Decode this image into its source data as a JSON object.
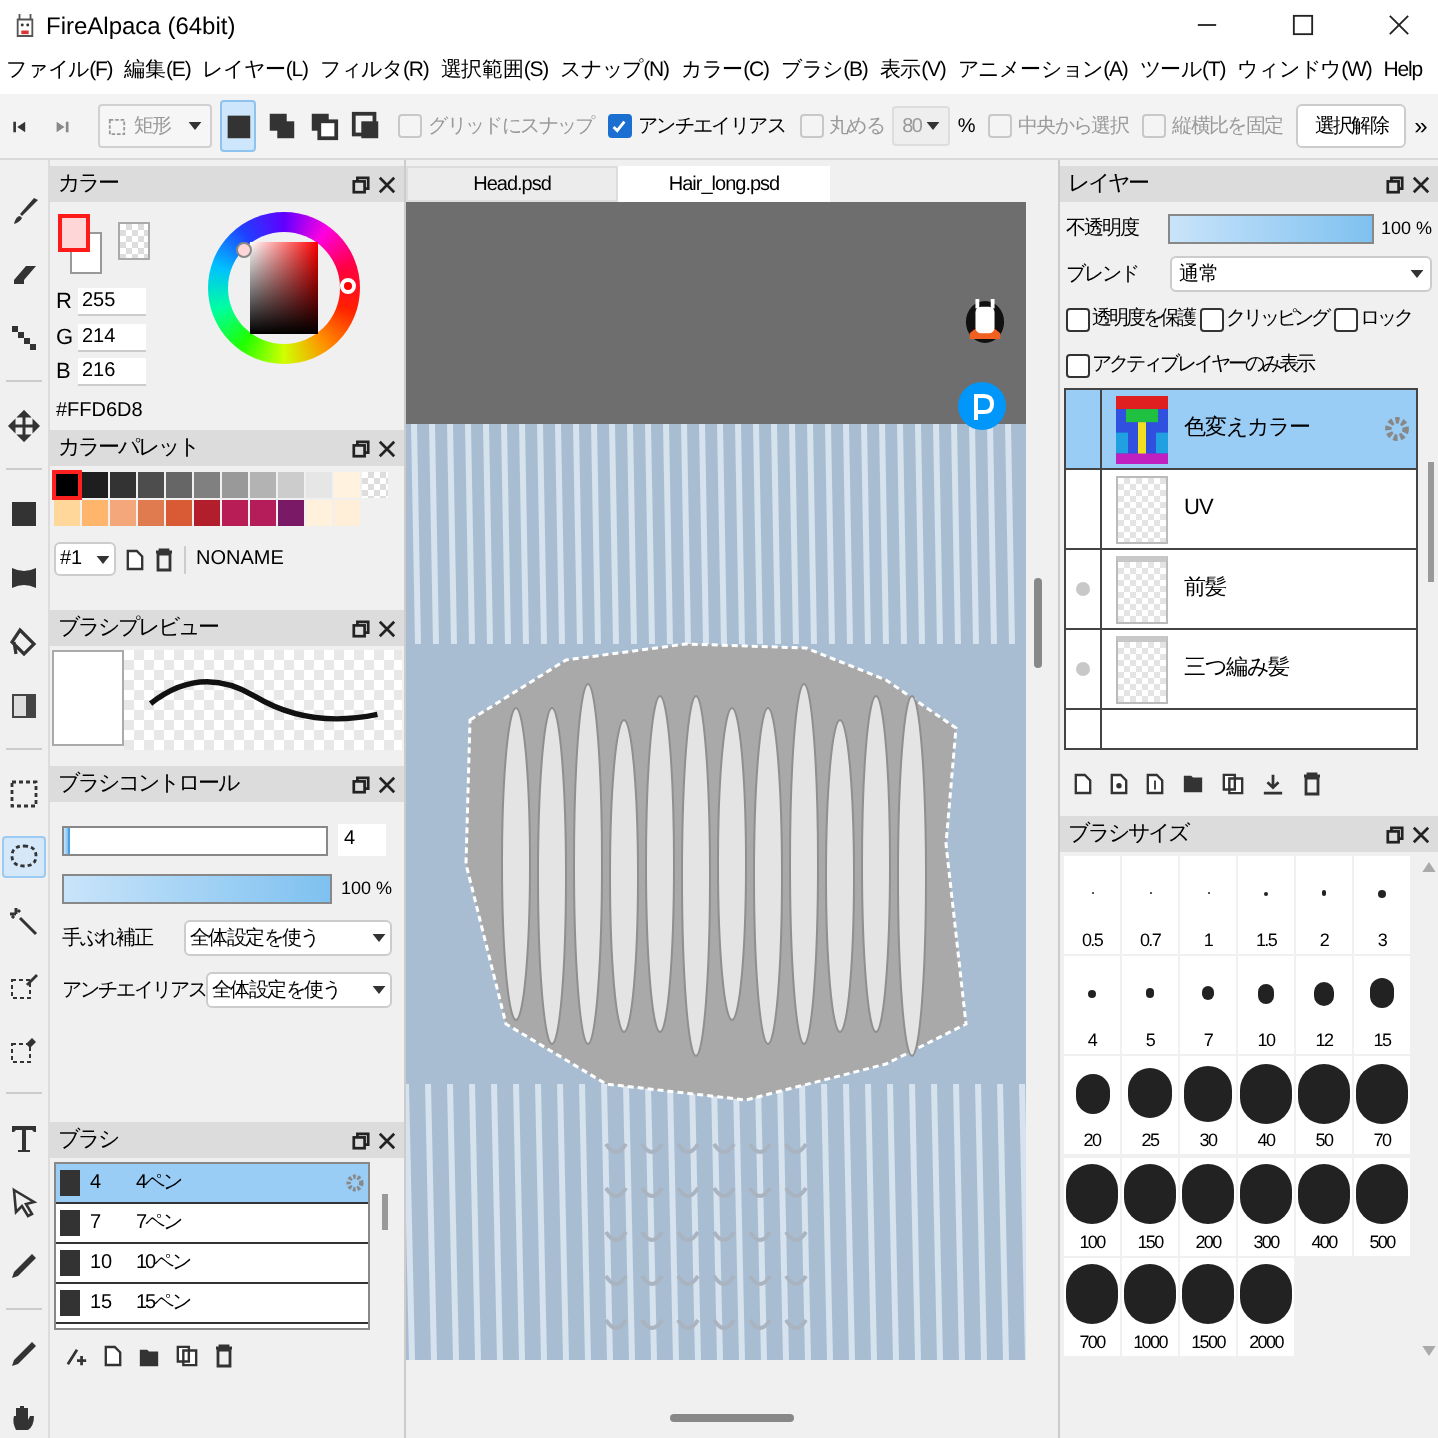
{
  "window": {
    "title": "FireAlpaca (64bit)"
  },
  "menu": [
    "ファイル(F)",
    "編集(E)",
    "レイヤー(L)",
    "フィルタ(R)",
    "選択範囲(S)",
    "スナップ(N)",
    "カラー(C)",
    "ブラシ(B)",
    "表示(V)",
    "アニメーション(A)",
    "ツール(T)",
    "ウィンドウ(W)",
    "Help"
  ],
  "toolbar": {
    "shape": "矩形",
    "modes": [
      {
        "selected": true
      },
      {
        "selected": false
      },
      {
        "selected": false
      },
      {
        "selected": false
      }
    ],
    "options": [
      {
        "kind": "check",
        "label": "グリッドにスナップ",
        "checked": false,
        "disabled": true
      },
      {
        "kind": "check",
        "label": "アンチエイリアス",
        "checked": true,
        "disabled": false
      },
      {
        "kind": "check",
        "label": "丸める",
        "checked": false,
        "disabled": true
      },
      {
        "kind": "select",
        "value": "80",
        "disabled": true
      },
      {
        "kind": "unit",
        "label": "%"
      },
      {
        "kind": "check",
        "label": "中央から選択",
        "checked": false,
        "disabled": true
      },
      {
        "kind": "check",
        "label": "縦横比を固定",
        "checked": false,
        "disabled": true
      },
      {
        "kind": "button",
        "label": "選択解除"
      }
    ],
    "overflow": "»"
  },
  "tools": [
    {
      "selected": false
    },
    {
      "selected": false
    },
    {
      "selected": false
    },
    {
      "selected": false
    },
    {
      "selected": false
    },
    {
      "selected": false
    },
    {
      "selected": false
    },
    {
      "selected": false
    },
    {
      "selected": false
    },
    {
      "selected": true
    },
    {
      "selected": false
    },
    {
      "selected": false
    },
    {
      "selected": false
    },
    {
      "selected": false
    },
    {
      "selected": false
    },
    {
      "selected": false
    },
    {
      "selected": false
    },
    {
      "selected": false
    }
  ],
  "color_panel": {
    "title": "カラー",
    "channels": [
      {
        "label": "R",
        "value": "255"
      },
      {
        "label": "G",
        "value": "214"
      },
      {
        "label": "B",
        "value": "216"
      }
    ],
    "hex": "#FFD6D8"
  },
  "palette_panel": {
    "title": "カラーパレット",
    "swatches": [
      {
        "color": "#000000",
        "selected": true
      },
      {
        "color": "#1e1e1e",
        "selected": false
      },
      {
        "color": "#333333",
        "selected": false
      },
      {
        "color": "#4d4d4d",
        "selected": false
      },
      {
        "color": "#666666",
        "selected": false
      },
      {
        "color": "#808080",
        "selected": false
      },
      {
        "color": "#999999",
        "selected": false
      },
      {
        "color": "#b3b3b3",
        "selected": false
      },
      {
        "color": "#cccccc",
        "selected": false
      },
      {
        "color": "#e6e6e6",
        "selected": false
      },
      {
        "color": "#fff3e0",
        "selected": false
      },
      {
        "color": "#ffd79b",
        "selected": false
      },
      {
        "color": "#ffb56b",
        "selected": false
      },
      {
        "color": "#f4a77a",
        "selected": false
      },
      {
        "color": "#e07b4f",
        "selected": false
      },
      {
        "color": "#d95b36",
        "selected": false
      },
      {
        "color": "#b31e2d",
        "selected": false
      },
      {
        "color": "#b81e55",
        "selected": false
      },
      {
        "color": "#b51d5a",
        "selected": false
      },
      {
        "color": "#7a1a66",
        "selected": false
      },
      {
        "color": "#fff1dc",
        "selected": false
      },
      {
        "color": "#ffefd8",
        "selected": false
      }
    ],
    "number": "#1",
    "name": "NONAME"
  },
  "brush_preview": {
    "title": "ブラシプレビュー"
  },
  "brush_control": {
    "title": "ブラシコントロール",
    "size": {
      "level": 0.02,
      "value": "4"
    },
    "opacity": {
      "level": 1,
      "reading": "100 %"
    },
    "settings": [
      {
        "label": "手ぶれ補正",
        "value": "全体設定を使う"
      },
      {
        "label": "アンチエイリアス",
        "value": "全体設定を使う"
      }
    ]
  },
  "brush_panel": {
    "title": "ブラシ",
    "brushes": [
      {
        "size": "4",
        "name": "4ペン",
        "selected": true
      },
      {
        "size": "7",
        "name": "7ペン",
        "selected": false
      },
      {
        "size": "10",
        "name": "10ペン",
        "selected": false
      },
      {
        "size": "15",
        "name": "15ペン",
        "selected": false
      }
    ]
  },
  "tabs": [
    {
      "label": "Head.psd",
      "selected": false
    },
    {
      "label": "Hair_long.psd",
      "selected": true
    }
  ],
  "layer_panel": {
    "title": "レイヤー",
    "opacity_label": "不透明度",
    "opacity": {
      "level": 1,
      "reading": "100 %"
    },
    "blend_label": "ブレンド",
    "blend": "通常",
    "options": [
      {
        "label": "透明度を保護",
        "checked": false
      },
      {
        "label": "クリッピング",
        "checked": false
      },
      {
        "label": "ロック",
        "checked": false
      },
      {
        "label": "アクティブレイヤーのみ表示",
        "checked": false
      }
    ],
    "layers": [
      {
        "name": "色変えカラー",
        "selected": true,
        "marked": false,
        "kind": "colormap"
      },
      {
        "name": "UV",
        "selected": false,
        "marked": false,
        "kind": "blank"
      },
      {
        "name": "前髪",
        "selected": false,
        "marked": true,
        "kind": "sketch"
      },
      {
        "name": "三つ編み髪",
        "selected": false,
        "marked": true,
        "kind": "sketch"
      }
    ]
  },
  "brush_size_panel": {
    "title": "ブラシサイズ",
    "sizes": [
      "0.5",
      "0.7",
      "1",
      "1.5",
      "2",
      "3",
      "4",
      "5",
      "7",
      "10",
      "12",
      "15",
      "20",
      "25",
      "30",
      "40",
      "50",
      "70",
      "100",
      "150",
      "200",
      "300",
      "400",
      "500",
      "700",
      "1000",
      "1500",
      "2000"
    ]
  }
}
